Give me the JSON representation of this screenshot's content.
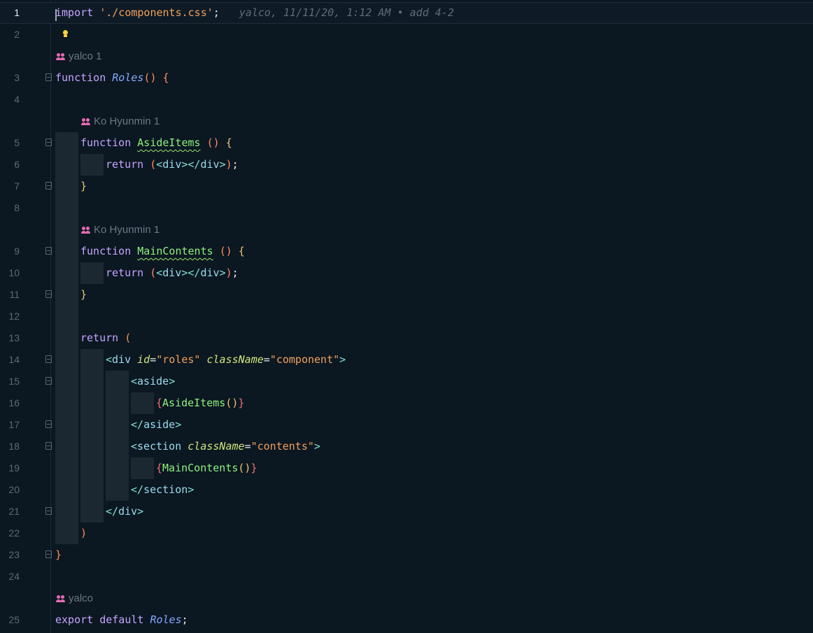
{
  "editor": {
    "lines": [
      {
        "n": "1",
        "active": true,
        "indent": 0,
        "fold": false,
        "tokens": [
          [
            "kw",
            "import"
          ],
          [
            "punct",
            " "
          ],
          [
            "str",
            "'./components.css'"
          ],
          [
            "punct",
            ";"
          ]
        ],
        "blame": "yalco, 11/11/20, 1:12 AM • add 4-2"
      },
      {
        "n": "2",
        "indent": 0,
        "fold": false,
        "tokens": []
      },
      {
        "lens": "yalco 1",
        "indent": 0
      },
      {
        "n": "3",
        "indent": 0,
        "fold": true,
        "tokens": [
          [
            "kw",
            "function"
          ],
          [
            "punct",
            " "
          ],
          [
            "fn-it",
            "Roles"
          ],
          [
            "paren2",
            "()"
          ],
          [
            "punct",
            " "
          ],
          [
            "paren2",
            "{"
          ]
        ]
      },
      {
        "n": "4",
        "indent": 0,
        "fold": false,
        "tokens": []
      },
      {
        "lens": "Ko Hyunmin 1",
        "indent": 1
      },
      {
        "n": "5",
        "indent": 1,
        "fold": true,
        "tokens": [
          [
            "kw",
            "function"
          ],
          [
            "punct",
            " "
          ],
          [
            "fn-green",
            "AsideItems"
          ],
          [
            "punct",
            " "
          ],
          [
            "paren2",
            "()"
          ],
          [
            "punct",
            " "
          ],
          [
            "paren",
            "{"
          ]
        ]
      },
      {
        "n": "6",
        "indent": 2,
        "fold": false,
        "tokens": [
          [
            "kw",
            "return"
          ],
          [
            "punct",
            " "
          ],
          [
            "paren2",
            "("
          ],
          [
            "tag",
            "<"
          ],
          [
            "tagname",
            "div"
          ],
          [
            "tag",
            "></"
          ],
          [
            "tagname",
            "div"
          ],
          [
            "tag",
            ">"
          ],
          [
            "paren2",
            ")"
          ],
          [
            "punct",
            ";"
          ]
        ]
      },
      {
        "n": "7",
        "indent": 1,
        "fold": true,
        "foldEnd": true,
        "tokens": [
          [
            "paren",
            "}"
          ]
        ]
      },
      {
        "n": "8",
        "indent": 1,
        "fold": false,
        "tokens": []
      },
      {
        "lens": "Ko Hyunmin 1",
        "indent": 1
      },
      {
        "n": "9",
        "indent": 1,
        "fold": true,
        "tokens": [
          [
            "kw",
            "function"
          ],
          [
            "punct",
            " "
          ],
          [
            "fn-green",
            "MainContents"
          ],
          [
            "punct",
            " "
          ],
          [
            "paren2",
            "()"
          ],
          [
            "punct",
            " "
          ],
          [
            "paren",
            "{"
          ]
        ]
      },
      {
        "n": "10",
        "indent": 2,
        "fold": false,
        "tokens": [
          [
            "kw",
            "return"
          ],
          [
            "punct",
            " "
          ],
          [
            "paren2",
            "("
          ],
          [
            "tag",
            "<"
          ],
          [
            "tagname",
            "div"
          ],
          [
            "tag",
            "></"
          ],
          [
            "tagname",
            "div"
          ],
          [
            "tag",
            ">"
          ],
          [
            "paren2",
            ")"
          ],
          [
            "punct",
            ";"
          ]
        ]
      },
      {
        "n": "11",
        "indent": 1,
        "fold": true,
        "foldEnd": true,
        "tokens": [
          [
            "paren",
            "}"
          ]
        ]
      },
      {
        "n": "12",
        "indent": 1,
        "fold": false,
        "tokens": []
      },
      {
        "n": "13",
        "indent": 1,
        "fold": false,
        "tokens": [
          [
            "kw",
            "return"
          ],
          [
            "punct",
            " "
          ],
          [
            "paren2",
            "("
          ]
        ]
      },
      {
        "n": "14",
        "indent": 2,
        "fold": true,
        "tokens": [
          [
            "tag",
            "<"
          ],
          [
            "tagname",
            "div"
          ],
          [
            "punct",
            " "
          ],
          [
            "attr",
            "id"
          ],
          [
            "punct",
            "="
          ],
          [
            "str",
            "\"roles\""
          ],
          [
            "punct",
            " "
          ],
          [
            "attr",
            "className"
          ],
          [
            "punct",
            "="
          ],
          [
            "str",
            "\"component\""
          ],
          [
            "tag",
            ">"
          ]
        ]
      },
      {
        "n": "15",
        "indent": 3,
        "fold": true,
        "tokens": [
          [
            "tag",
            "<"
          ],
          [
            "tagname",
            "aside"
          ],
          [
            "tag",
            ">"
          ]
        ]
      },
      {
        "n": "16",
        "indent": 4,
        "fold": false,
        "tokens": [
          [
            "brace",
            "{"
          ],
          [
            "fn-call",
            "AsideItems"
          ],
          [
            "paren",
            "()"
          ],
          [
            "brace",
            "}"
          ]
        ]
      },
      {
        "n": "17",
        "indent": 3,
        "fold": true,
        "foldEnd": true,
        "tokens": [
          [
            "tag",
            "</"
          ],
          [
            "tagname",
            "aside"
          ],
          [
            "tag",
            ">"
          ]
        ]
      },
      {
        "n": "18",
        "indent": 3,
        "fold": true,
        "tokens": [
          [
            "tag",
            "<"
          ],
          [
            "tagname",
            "section"
          ],
          [
            "punct",
            " "
          ],
          [
            "attr",
            "className"
          ],
          [
            "punct",
            "="
          ],
          [
            "str",
            "\"contents\""
          ],
          [
            "tag",
            ">"
          ]
        ]
      },
      {
        "n": "19",
        "indent": 4,
        "fold": false,
        "tokens": [
          [
            "brace",
            "{"
          ],
          [
            "fn-call",
            "MainContents"
          ],
          [
            "paren",
            "()"
          ],
          [
            "brace",
            "}"
          ]
        ]
      },
      {
        "n": "20",
        "indent": 3,
        "fold": false,
        "tokens": [
          [
            "tag",
            "</"
          ],
          [
            "tagname",
            "section"
          ],
          [
            "tag",
            ">"
          ]
        ]
      },
      {
        "n": "21",
        "indent": 2,
        "fold": true,
        "foldEnd": true,
        "tokens": [
          [
            "tag",
            "</"
          ],
          [
            "tagname",
            "div"
          ],
          [
            "tag",
            ">"
          ]
        ]
      },
      {
        "n": "22",
        "indent": 1,
        "fold": false,
        "tokens": [
          [
            "paren2",
            ")"
          ]
        ]
      },
      {
        "n": "23",
        "indent": 0,
        "fold": true,
        "foldEnd": true,
        "tokens": [
          [
            "paren2",
            "}"
          ]
        ]
      },
      {
        "n": "24",
        "indent": 0,
        "fold": false,
        "tokens": []
      },
      {
        "lens": "yalco",
        "indent": 0
      },
      {
        "n": "25",
        "indent": 0,
        "fold": false,
        "tokens": [
          [
            "kw",
            "export"
          ],
          [
            "punct",
            " "
          ],
          [
            "kw",
            "default"
          ],
          [
            "punct",
            " "
          ],
          [
            "fn-it",
            "Roles"
          ],
          [
            "punct",
            ";"
          ]
        ]
      }
    ]
  },
  "icons": {
    "lightbulb": "lightbulb-icon",
    "people": "people-icon"
  },
  "colors": {
    "background": "#0b1721",
    "keyword": "#c5a5ff",
    "string": "#f2a05b",
    "lens_icon": "#e86bb6"
  }
}
